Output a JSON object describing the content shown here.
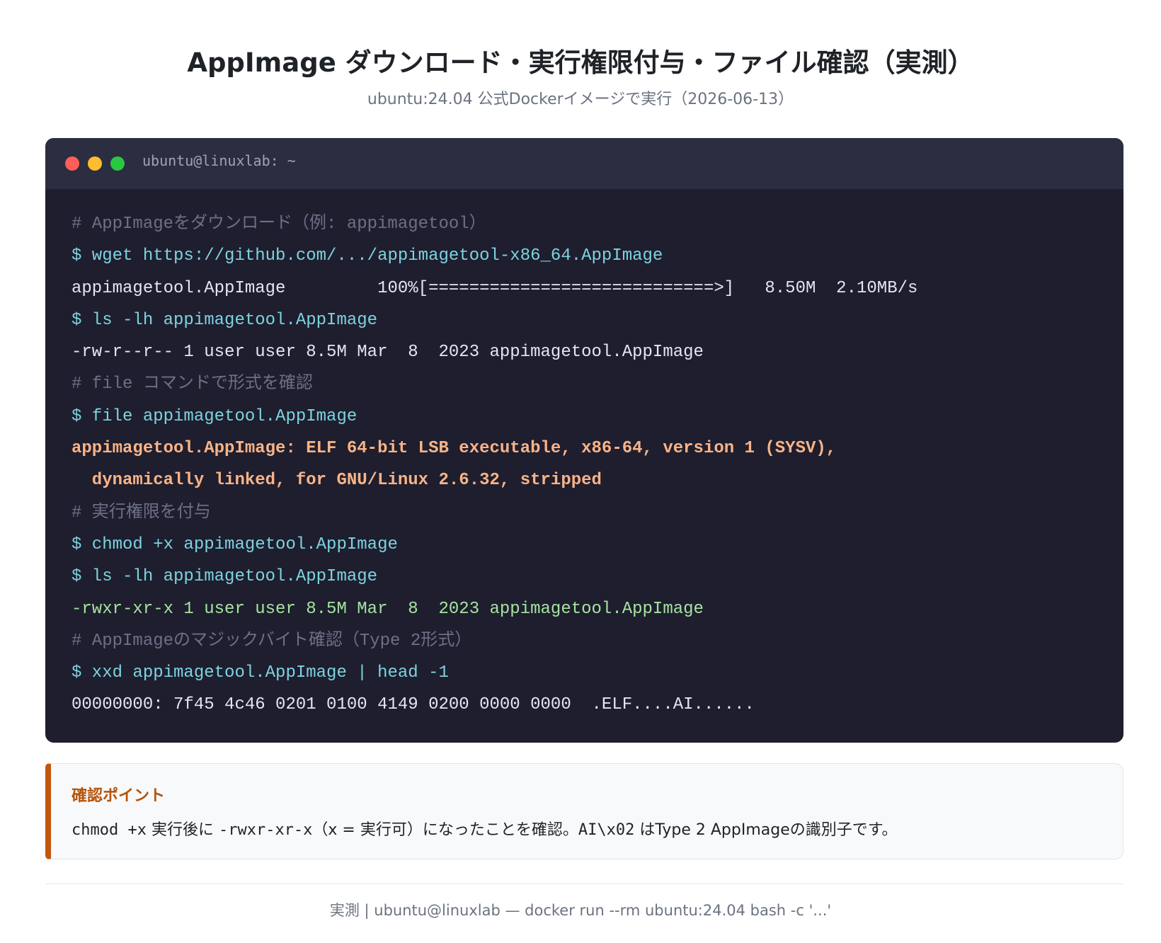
{
  "page": {
    "title": "AppImage ダウンロード・実行権限付与・ファイル確認（実測）",
    "subtitle": "ubuntu:24.04 公式Dockerイメージで実行（2026-06-13）"
  },
  "terminal": {
    "window_title": "ubuntu@linuxlab: ~",
    "lines": [
      {
        "type": "comment",
        "text": "# AppImageをダウンロード（例: appimagetool）"
      },
      {
        "type": "cmd",
        "text": "$ wget https://github.com/.../appimagetool-x86_64.AppImage"
      },
      {
        "type": "out",
        "text": "appimagetool.AppImage         100%[============================>]   8.50M  2.10MB/s"
      },
      {
        "type": "cmd",
        "text": "$ ls -lh appimagetool.AppImage"
      },
      {
        "type": "out",
        "text": "-rw-r--r-- 1 user user 8.5M Mar  8  2023 appimagetool.AppImage"
      },
      {
        "type": "comment",
        "text": "# file コマンドで形式を確認"
      },
      {
        "type": "cmd",
        "text": "$ file appimagetool.AppImage"
      },
      {
        "type": "warn",
        "text": "appimagetool.AppImage: ELF 64-bit LSB executable, x86-64, version 1 (SYSV),"
      },
      {
        "type": "warn",
        "text": "  dynamically linked, for GNU/Linux 2.6.32, stripped"
      },
      {
        "type": "comment",
        "text": "# 実行権限を付与"
      },
      {
        "type": "cmd",
        "text": "$ chmod +x appimagetool.AppImage"
      },
      {
        "type": "cmd",
        "text": "$ ls -lh appimagetool.AppImage"
      },
      {
        "type": "ok",
        "text": "-rwxr-xr-x 1 user user 8.5M Mar  8  2023 appimagetool.AppImage"
      },
      {
        "type": "comment",
        "text": "# AppImageのマジックバイト確認（Type 2形式）"
      },
      {
        "type": "cmd",
        "text": "$ xxd appimagetool.AppImage | head -1"
      },
      {
        "type": "out",
        "text": "00000000: 7f45 4c46 0201 0100 4149 0200 0000 0000  .ELF....AI......"
      }
    ]
  },
  "note": {
    "title": "確認ポイント",
    "code1": "chmod +x",
    "text1": " 実行後に ",
    "code2": "-rwxr-xr-x",
    "text2": "（x = 実行可）になったことを確認。",
    "code3": "AI\\x02",
    "text3": " はType 2 AppImageの識別子です。"
  },
  "footer": {
    "text": "実測 | ubuntu@linuxlab — docker run --rm ubuntu:24.04 bash -c '...'"
  },
  "colors": {
    "terminal_bg": "#1e1e2e",
    "comment": "#6c7086",
    "command": "#7dd3e0",
    "output": "#e4e6f0",
    "highlight": "#fab387",
    "success": "#a6e3a1",
    "accent": "#c2570c"
  }
}
